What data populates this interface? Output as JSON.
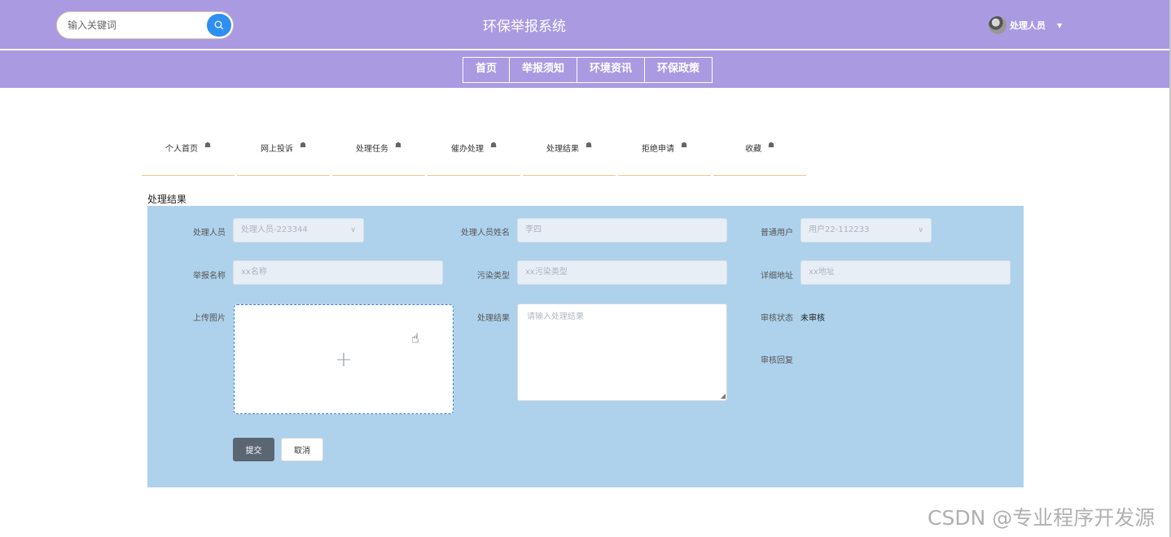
{
  "header": {
    "title": "环保举报系统",
    "search": {
      "placeholder": "输入关键词",
      "icon": "search-icon"
    },
    "user": {
      "name": "处理人员",
      "avatar": "avatar"
    }
  },
  "nav": {
    "items": [
      "首页",
      "举报须知",
      "环境资讯",
      "环保政策"
    ]
  },
  "tabs": [
    "个人首页",
    "网上投诉",
    "处理任务",
    "催办处理",
    "处理结果",
    "拒绝申请",
    "收藏"
  ],
  "section_title": "处理结果",
  "form": {
    "handler_label": "处理人员",
    "handler_value": "处理人员-223344",
    "handler_name_label": "处理人员姓名",
    "handler_name_value": "李四",
    "user_label": "普通用户",
    "user_value": "用户22-112233",
    "report_name_label": "举报名称",
    "report_name_value": "xx名称",
    "pollution_label": "污染类型",
    "pollution_value": "xx污染类型",
    "address_label": "详细地址",
    "address_value": "xx地址",
    "upload_label": "上传图片",
    "result_label": "处理结果",
    "result_placeholder": "请输入处理结果",
    "review_status_label": "审核状态",
    "review_status_value": "未审核",
    "review_reply_label": "审核回复",
    "submit": "提交",
    "cancel": "取消"
  },
  "watermark": "CSDN @专业程序开发源"
}
